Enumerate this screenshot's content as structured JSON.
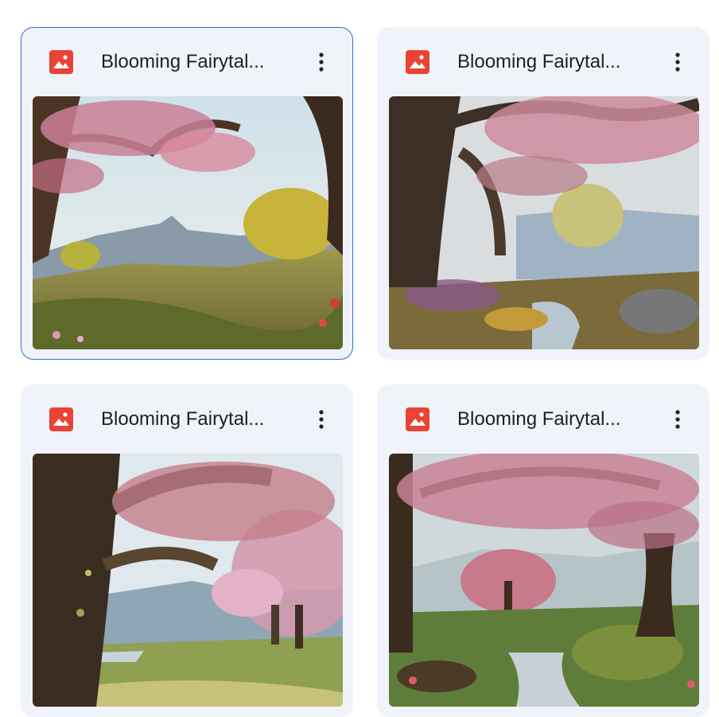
{
  "files": [
    {
      "name": "Blooming Fairytal...",
      "icon": "image-file-icon",
      "selected": true
    },
    {
      "name": "Blooming Fairytal...",
      "icon": "image-file-icon",
      "selected": false
    },
    {
      "name": "Blooming Fairytal...",
      "icon": "image-file-icon",
      "selected": false
    },
    {
      "name": "Blooming Fairytal...",
      "icon": "image-file-icon",
      "selected": false
    }
  ],
  "colors": {
    "card_bg": "#f0f3f9",
    "selected_border": "#3c6bd6",
    "icon_red": "#ea4335"
  }
}
